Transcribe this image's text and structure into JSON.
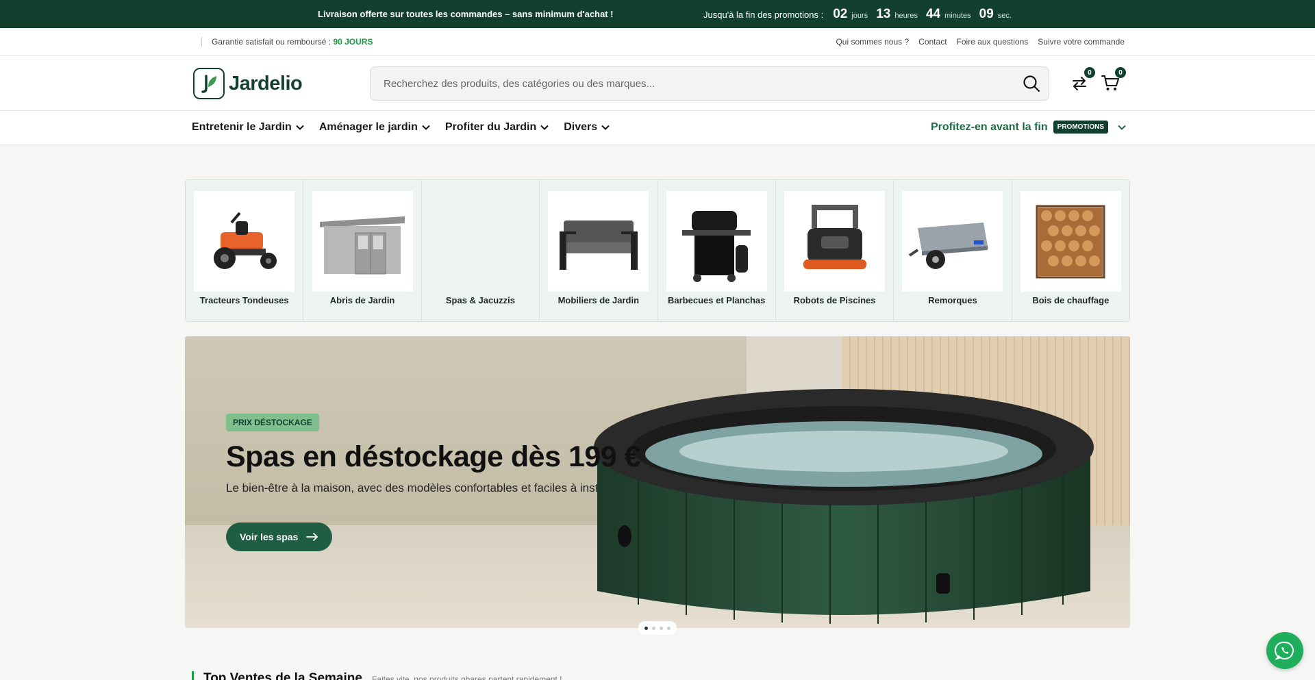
{
  "announcement": {
    "message": "Livraison offerte sur toutes les commandes – sans minimum d'achat !",
    "countdown_label": "Jusqu'à la fin des promotions :",
    "days": "02",
    "days_unit": "jours",
    "hours": "13",
    "hours_unit": "heures",
    "minutes": "44",
    "minutes_unit": "minutes",
    "seconds": "09",
    "seconds_unit": "sec."
  },
  "utility": {
    "guarantee_text": "Garantie satisfait ou remboursé :",
    "guarantee_days": "90 JOURS",
    "links": [
      "Qui sommes nous ?",
      "Contact",
      "Foire aux questions",
      "Suivre votre commande"
    ]
  },
  "header": {
    "brand": "Jardelio",
    "search_placeholder": "Recherchez des produits, des catégories ou des marques...",
    "compare_count": "0",
    "cart_count": "0"
  },
  "nav": {
    "items": [
      "Entretenir le Jardin",
      "Aménager le jardin",
      "Profiter du Jardin",
      "Divers"
    ],
    "promo_text": "Profitez-en avant la fin",
    "promo_badge": "PROMOTIONS"
  },
  "categories": [
    {
      "label": "Tracteurs Tondeuses",
      "icon": "lawn-tractor-icon"
    },
    {
      "label": "Abris de Jardin",
      "icon": "garden-shed-icon"
    },
    {
      "label": "Spas & Jacuzzis",
      "icon": "none"
    },
    {
      "label": "Mobiliers de Jardin",
      "icon": "sofa-icon"
    },
    {
      "label": "Barbecues et Planchas",
      "icon": "barbecue-icon"
    },
    {
      "label": "Robots de Piscines",
      "icon": "pool-robot-icon"
    },
    {
      "label": "Remorques",
      "icon": "trailer-icon"
    },
    {
      "label": "Bois de chauffage",
      "icon": "firewood-icon"
    }
  ],
  "hero": {
    "tag": "PRIX DÉSTOCKAGE",
    "title": "Spas en déstockage dès 199 €",
    "subtitle": "Le bien-être à la maison, avec des modèles confortables et faciles à installer.",
    "cta": "Voir les spas",
    "slide_count": 4,
    "active_slide": 1
  },
  "section": {
    "title": "Top Ventes de la Semaine",
    "subtitle": "Faites vite, nos produits phares partent rapidement !"
  },
  "colors": {
    "brand_dark": "#123f2e",
    "brand_green": "#1c9a45",
    "whatsapp": "#1fae5c"
  }
}
